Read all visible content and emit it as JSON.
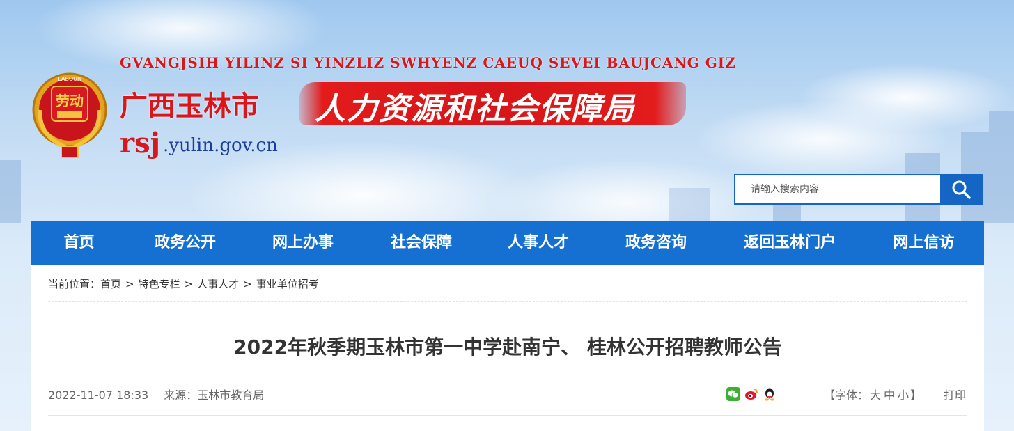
{
  "header": {
    "zhuang_title": "GVANGJSIH YILINZ SI YINZLIZ SWHYENZ CAEUQ SEVEI BAUJCANG GIZ",
    "city_title": "广西玉林市",
    "bureau_title": "人力资源和社会保障局",
    "domain_rsj": "rsj",
    "domain_rest": ".yulin.gov.cn",
    "logo_ring_text": "LABOUR",
    "logo_center_text": "劳动"
  },
  "search": {
    "placeholder": "请输入搜索内容",
    "icon": "search-icon"
  },
  "nav": {
    "items": [
      {
        "label": "首页"
      },
      {
        "label": "政务公开"
      },
      {
        "label": "网上办事"
      },
      {
        "label": "社会保障"
      },
      {
        "label": "人事人才"
      },
      {
        "label": "政务咨询"
      },
      {
        "label": "返回玉林门户"
      },
      {
        "label": "网上信访"
      }
    ]
  },
  "breadcrumb": {
    "prefix": "当前位置：",
    "items": [
      "首页",
      "特色专栏",
      "人事人才",
      "事业单位招考"
    ],
    "separator": ">"
  },
  "article": {
    "title": "2022年秋季期玉林市第一中学赴南宁、 桂林公开招聘教师公告",
    "date": "2022-11-07 18:33",
    "source": "来源：玉林市教育局"
  },
  "share": {
    "icons": [
      "wechat-icon",
      "weibo-icon",
      "qq-icon"
    ]
  },
  "fontsize": {
    "open": "【字体：",
    "large": "大",
    "medium": "中",
    "small": "小",
    "close": "】"
  },
  "print_label": "打印",
  "colors": {
    "nav_blue": "#1570d1",
    "brand_red": "#d8161c",
    "domain_blue": "#1b3d9c"
  }
}
